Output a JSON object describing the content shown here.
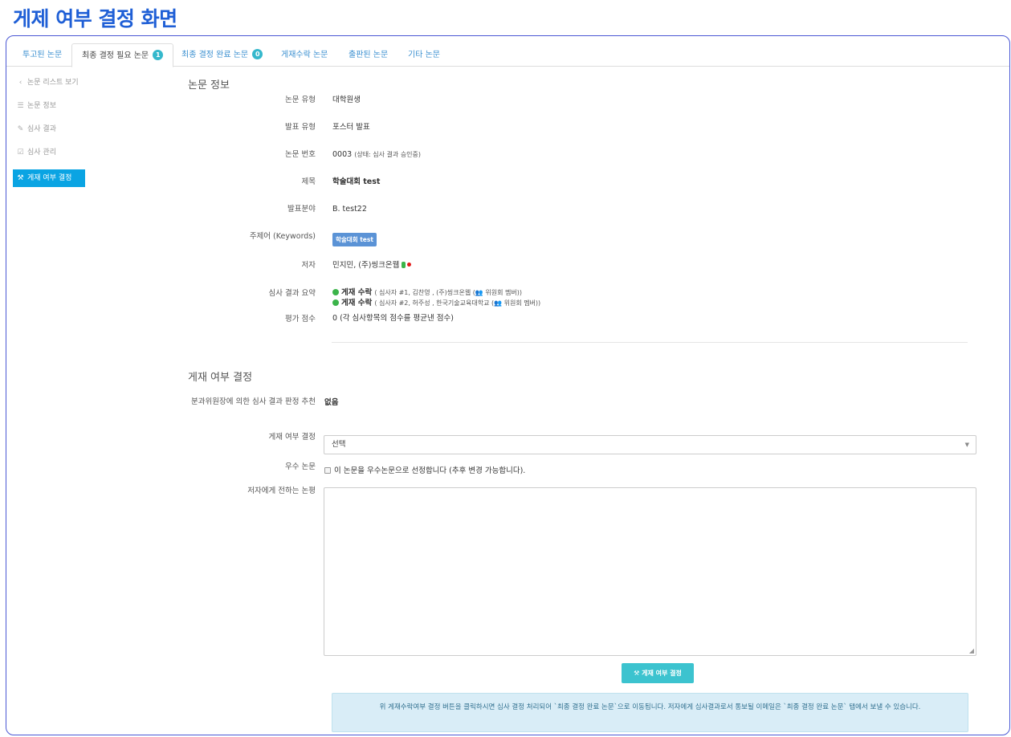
{
  "page_title": "게제 여부 결정 화면",
  "tabs": [
    {
      "label": "투고된 논문"
    },
    {
      "label": "최종 결정 필요 논문",
      "badge": "1"
    },
    {
      "label": "최종 결정 완료 논문",
      "badge": "0"
    },
    {
      "label": "게재수락 논문"
    },
    {
      "label": "출판된 논문"
    },
    {
      "label": "기타 논문"
    }
  ],
  "sidebar": {
    "items": [
      {
        "label": "논문 리스트 보기",
        "icon": "chevron-left-icon"
      },
      {
        "label": "논문 정보",
        "icon": "list-icon"
      },
      {
        "label": "심사 결과",
        "icon": "edit-icon"
      },
      {
        "label": "심사 관리",
        "icon": "check-square-icon"
      },
      {
        "label": "게재 여부 결정",
        "icon": "gavel-icon"
      }
    ]
  },
  "info": {
    "title": "논문 정보",
    "paper_type_label": "논문 유형",
    "paper_type": "대학원생",
    "presentation_type_label": "발표 유형",
    "presentation_type": "포스터 발표",
    "paper_number_label": "논문 번호",
    "paper_number": "0003",
    "paper_status": "(상태: 심사 결과 승인중)",
    "paper_title_label": "제목",
    "paper_title": "학술대회 test",
    "field_label": "발표분야",
    "field": "B. test22",
    "keywords_label": "주제어 (Keywords)",
    "keyword": "학술대회 test",
    "author_label": "저자",
    "author": "민지민, (주)씽크온웹",
    "review_summary_label": "심사 결과 요약",
    "reviews": [
      {
        "result": "게재 수락",
        "detail": "( 심사자 #1, 김찬영 , (주)씽크온웹 (👥 위원회 멤버))"
      },
      {
        "result": "게재 수락",
        "detail": "( 심사자 #2, 허주성 , 한국기술교육대학교 (👥 위원회 멤버))"
      }
    ],
    "score_label": "평가 점수",
    "score": "0 (각 심사항목의 점수를 평균낸 점수)"
  },
  "decision": {
    "title": "게재 여부 결정",
    "recommend_label": "분과위원장에 의한 심사 결과 판정 추천",
    "recommend_value": "없음",
    "decision_label": "게재 여부 결정",
    "decision_selected": "선택",
    "excellent_label": "우수 논문",
    "excellent_checkbox_text": "이 논문을 우수논문으로 선정합니다 (추후 변경 가능합니다).",
    "comment_label": "저자에게 전하는 논평",
    "submit_label": "게재 여부 결정",
    "notice": "위 게재수락여부 결정 버튼을 클릭하시면 심사 결정 처리되어 `최종 결정 완료 논문`으로 이동됩니다. 저자에게 심사결과로서 통보될 이메일은 `최종 결정 완료 논문` 탭에서 보낼 수 있습니다."
  },
  "colors": {
    "title_blue": "#1f5fd6",
    "frame_border": "#4a57d4",
    "sidebar_active": "#0aa4e3",
    "button_teal": "#3cc3cf",
    "notice_bg": "#d9edf7"
  }
}
